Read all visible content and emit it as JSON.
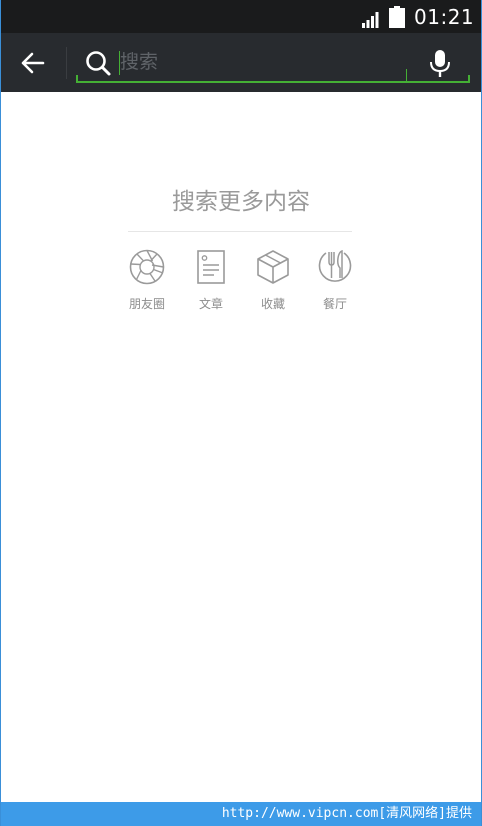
{
  "status_bar": {
    "time": "01:21"
  },
  "search": {
    "placeholder": "搜索",
    "value": ""
  },
  "content": {
    "title": "搜索更多内容",
    "categories": [
      {
        "label": "朋友圈",
        "icon": "moments-icon"
      },
      {
        "label": "文章",
        "icon": "article-icon"
      },
      {
        "label": "收藏",
        "icon": "favorites-icon"
      },
      {
        "label": "餐厅",
        "icon": "restaurant-icon"
      }
    ]
  },
  "footer": {
    "watermark": "http://www.vipcn.com[清风网络]提供"
  },
  "colors": {
    "accent": "#45b035",
    "toolbar": "#282b2f",
    "status": "#1a1b1c",
    "footer": "#3d9be8"
  }
}
